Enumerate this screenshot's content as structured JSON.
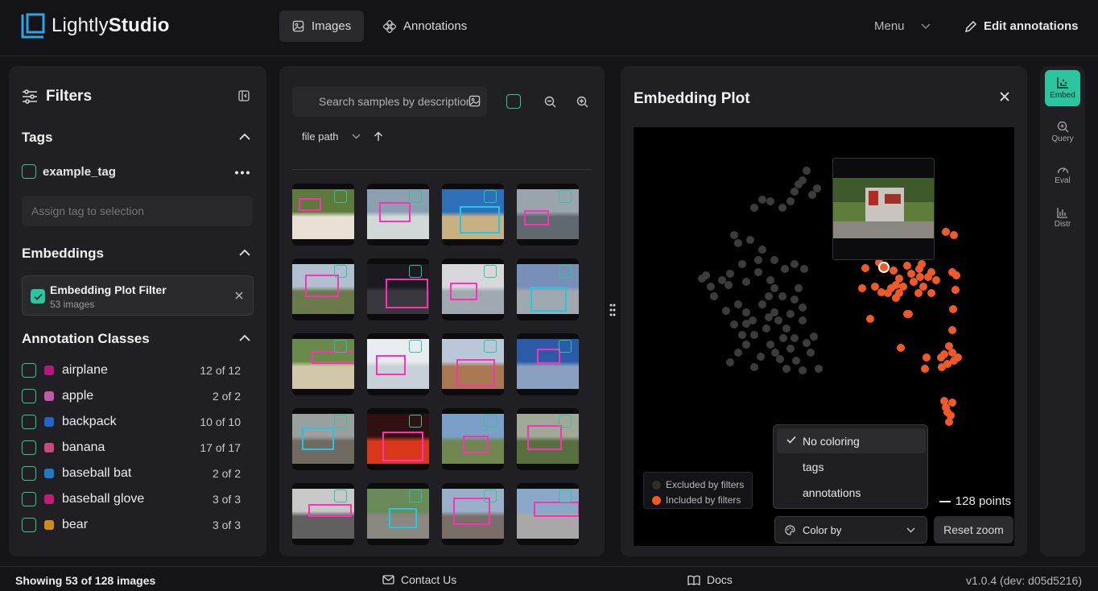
{
  "app": {
    "name_light": "Lightly",
    "name_bold": "Studio"
  },
  "nav": {
    "images": "Images",
    "annotations": "Annotations",
    "menu": "Menu",
    "edit": "Edit annotations"
  },
  "filters": {
    "title": "Filters",
    "tags_title": "Tags",
    "tag": "example_tag",
    "assign_placeholder": "Assign tag to selection",
    "embeddings_title": "Embeddings",
    "embedding_filter": {
      "name": "Embedding Plot Filter",
      "sub": "53 images"
    },
    "classes_title": "Annotation Classes",
    "classes": [
      {
        "name": "airplane",
        "count": "12 of 12",
        "color": "#b0197e"
      },
      {
        "name": "apple",
        "count": "2 of 2",
        "color": "#c05aa8"
      },
      {
        "name": "backpack",
        "count": "10 of 10",
        "color": "#1e66c8"
      },
      {
        "name": "banana",
        "count": "17 of 17",
        "color": "#c84a7c"
      },
      {
        "name": "baseball bat",
        "count": "2 of 2",
        "color": "#1c7ac8"
      },
      {
        "name": "baseball glove",
        "count": "3 of 3",
        "color": "#c01c78"
      },
      {
        "name": "bear",
        "count": "3 of 3",
        "color": "#d08a1c"
      }
    ]
  },
  "grid": {
    "search_placeholder": "Search samples by description",
    "sort_field": "file path"
  },
  "plot": {
    "title": "Embedding Plot",
    "legend_excluded": "Excluded by filters",
    "legend_included": "Included by filters",
    "coloring_options": [
      "No coloring",
      "tags",
      "annotations"
    ],
    "selected_coloring": "No coloring",
    "points": "128 points",
    "color_by": "Color by",
    "reset_zoom": "Reset zoom",
    "excluded_color": "#3c3c3c",
    "included_color": "#f05a28"
  },
  "side": {
    "embed": "Embed",
    "query": "Query",
    "eval": "Eval",
    "distr": "Distr"
  },
  "footer": {
    "showing": "Showing 53 of 128 images",
    "contact": "Contact Us",
    "docs": "Docs",
    "version": "v1.0.4 (dev: d05d5216)"
  }
}
